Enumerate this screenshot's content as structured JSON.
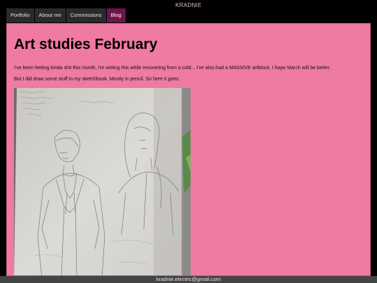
{
  "site": {
    "title": "KRADNIE"
  },
  "nav": {
    "items": [
      {
        "label": "Portfolio"
      },
      {
        "label": "About me"
      },
      {
        "label": "Commissions"
      },
      {
        "label": "Blog",
        "active": true
      }
    ]
  },
  "post": {
    "title": "Art studies February",
    "paragraphs": [
      "I've been feeling kinda shit this month, I'm writing this while recovering from a cold... I've also had a MASSIVE artblock. I hope March will be better.",
      "But I did draw some stuff in my sketchbook. Mostly in pencil. So here it goes."
    ],
    "image": {
      "description": "sketchbook page photo",
      "icon": "pencil-sketch-image"
    }
  },
  "footer": {
    "email": "kradnie.electric@gmail.com"
  },
  "colors": {
    "background": "#000000",
    "content_bg": "#ef7aa2",
    "nav_bg": "#2a2a2a",
    "nav_active_bg": "#6e1446",
    "footer_bg": "#444444"
  }
}
